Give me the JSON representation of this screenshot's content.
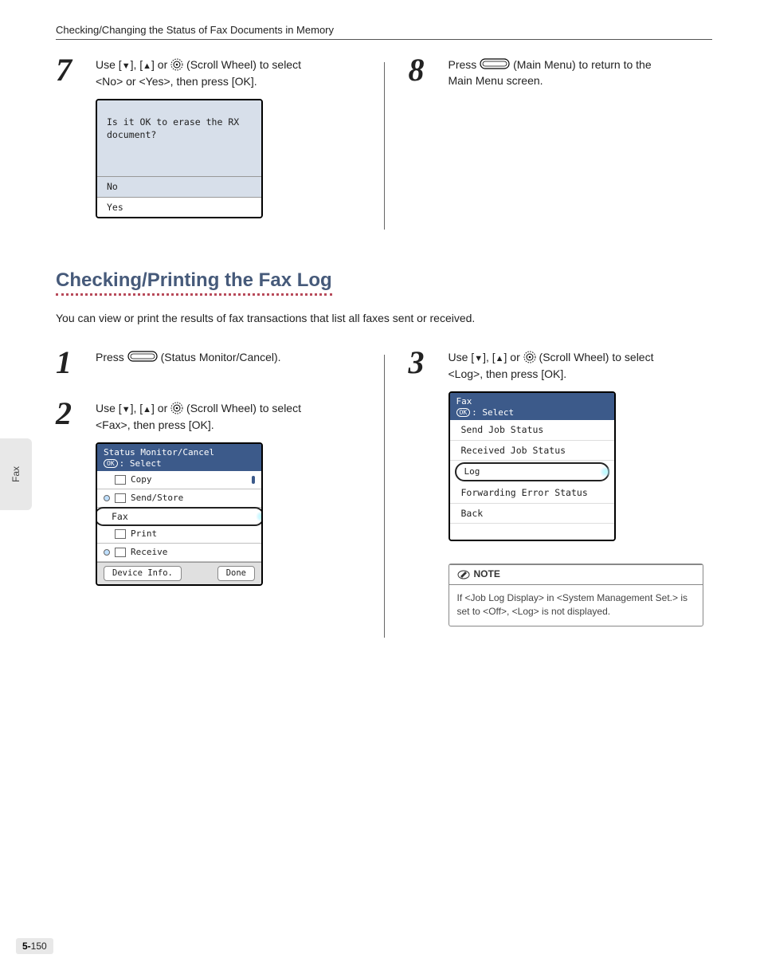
{
  "header": "Checking/Changing the Status of Fax Documents in Memory",
  "side_tab": "Fax",
  "page_number_prefix": "5-",
  "page_number": "150",
  "top": {
    "step7": {
      "num": "7",
      "line1_a": "Use [",
      "line1_b": "], [",
      "line1_c": "] or ",
      "line1_d": " (Scroll Wheel) to select",
      "line2": "<No> or <Yes>, then press [OK].",
      "lcd_msg_1": "Is it OK to erase the RX",
      "lcd_msg_2": "document?",
      "lcd_no": "No",
      "lcd_yes": "Yes"
    },
    "step8": {
      "num": "8",
      "line1_a": "Press ",
      "line1_b": " (Main Menu) to return to the",
      "line2": "Main Menu screen."
    }
  },
  "section": {
    "heading": "Checking/Printing the Fax Log",
    "intro": "You can view or print the results of fax transactions that list all faxes sent or received."
  },
  "steps": {
    "step1": {
      "num": "1",
      "line1_a": "Press ",
      "line1_b": " (Status Monitor/Cancel)."
    },
    "step2": {
      "num": "2",
      "line1_a": "Use [",
      "line1_b": "], [",
      "line1_c": "] or ",
      "line1_d": " (Scroll Wheel) to select",
      "line2": "<Fax>, then press [OK].",
      "lcd_title1": "Status Monitor/Cancel",
      "lcd_title2": ": Select",
      "items": {
        "copy": "Copy",
        "sendstore": "Send/Store",
        "fax": "Fax",
        "print": "Print",
        "receive": "Receive"
      },
      "footer_left": "Device Info.",
      "footer_right": "Done"
    },
    "step3": {
      "num": "3",
      "line1_a": "Use [",
      "line1_b": "], [",
      "line1_c": "] or ",
      "line1_d": " (Scroll Wheel) to select",
      "line2": "<Log>, then press [OK].",
      "lcd_title1": "Fax",
      "lcd_title2": ": Select",
      "items": {
        "send": "Send Job Status",
        "recv": "Received Job Status",
        "log": "Log",
        "fwd": "Forwarding Error Status",
        "back": "Back"
      }
    }
  },
  "note": {
    "title": "NOTE",
    "body": "If <Job Log Display> in <System Management Set.> is set to <Off>, <Log> is not displayed."
  }
}
